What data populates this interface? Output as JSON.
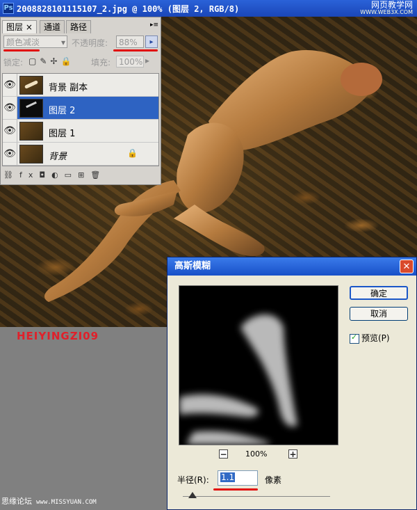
{
  "window": {
    "title": "2008828101115107_2.jpg @ 100% (图层 2, RGB/8)",
    "watermark_line1": "网页教学网",
    "watermark_line2": "WWW.WEB3X.COM"
  },
  "canvas": {
    "author_tag": "HEIYINGZI09"
  },
  "layers_panel": {
    "tabs": [
      {
        "label": "图层 ×",
        "active": true
      },
      {
        "label": "通道",
        "active": false
      },
      {
        "label": "路径",
        "active": false
      }
    ],
    "blend_mode": "颜色减淡",
    "opacity_label": "不透明度:",
    "opacity_value": "88%",
    "lock_label": "锁定:",
    "fill_label": "填充:",
    "fill_value": "100%",
    "layers": [
      {
        "name": "背景 副本",
        "selected": false,
        "italic": false,
        "locked": false
      },
      {
        "name": "图层 2",
        "selected": true,
        "italic": false,
        "locked": false
      },
      {
        "name": "图层 1",
        "selected": false,
        "italic": false,
        "locked": false
      },
      {
        "name": "背景",
        "selected": false,
        "italic": true,
        "locked": true
      }
    ],
    "highlight_color": "#2e63c2",
    "annotation_color": "#e10a0a"
  },
  "gaussian_blur_dialog": {
    "title": "高斯模糊",
    "ok_label": "确定",
    "cancel_label": "取消",
    "preview_label": "预览(P)",
    "preview_checked": true,
    "zoom_out": "−",
    "zoom_in": "+",
    "zoom_level": "100%",
    "radius_label": "半径(R):",
    "radius_value": "1.1",
    "radius_unit": "像素",
    "radius_slider_level": 0.03
  },
  "footer": {
    "forum": "思缘论坛",
    "site": "www.MISSYUAN.COM"
  }
}
